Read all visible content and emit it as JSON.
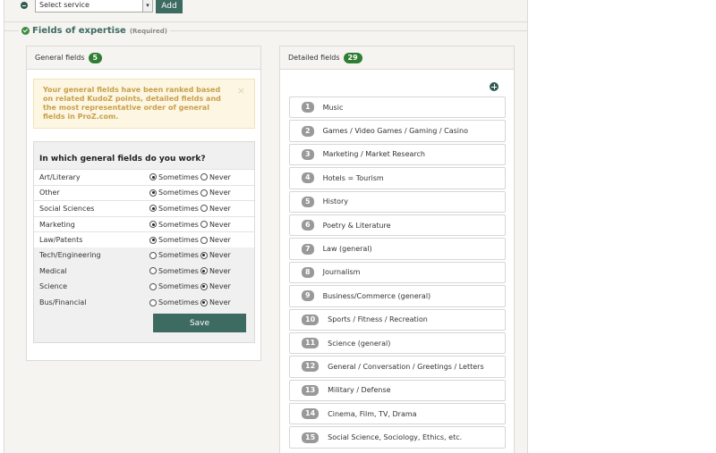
{
  "service": {
    "select_value": "Select service",
    "add_label": "Add"
  },
  "section": {
    "title": "Fields of expertise",
    "required": "(Required)"
  },
  "general": {
    "header": "General fields",
    "count": "5",
    "notice": "Your general fields have been ranked based on related KudoZ points, detailed fields and the most representative order of general fields in ProZ.com.",
    "close_glyph": "×",
    "question": "In which general fields do you work?",
    "option_sometimes": "Sometimes",
    "option_never": "Never",
    "rows": [
      {
        "label": "Art/Literary",
        "value": "Sometimes"
      },
      {
        "label": "Other",
        "value": "Sometimes"
      },
      {
        "label": "Social Sciences",
        "value": "Sometimes"
      },
      {
        "label": "Marketing",
        "value": "Sometimes"
      },
      {
        "label": "Law/Patents",
        "value": "Sometimes"
      },
      {
        "label": "Tech/Engineering",
        "value": "Never"
      },
      {
        "label": "Medical",
        "value": "Never"
      },
      {
        "label": "Science",
        "value": "Never"
      },
      {
        "label": "Bus/Financial",
        "value": "Never"
      }
    ],
    "save_label": "Save"
  },
  "detailed": {
    "header": "Detailed fields",
    "count": "29",
    "items": [
      {
        "num": "1",
        "label": "Music"
      },
      {
        "num": "2",
        "label": "Games / Video Games / Gaming / Casino"
      },
      {
        "num": "3",
        "label": "Marketing / Market Research"
      },
      {
        "num": "4",
        "label": "Hotels = Tourism"
      },
      {
        "num": "5",
        "label": "History"
      },
      {
        "num": "6",
        "label": "Poetry & Literature"
      },
      {
        "num": "7",
        "label": "Law (general)"
      },
      {
        "num": "8",
        "label": "Journalism"
      },
      {
        "num": "9",
        "label": "Business/Commerce (general)"
      },
      {
        "num": "10",
        "label": "Sports / Fitness / Recreation"
      },
      {
        "num": "11",
        "label": "Science (general)"
      },
      {
        "num": "12",
        "label": "General / Conversation / Greetings / Letters"
      },
      {
        "num": "13",
        "label": "Military / Defense"
      },
      {
        "num": "14",
        "label": "Cinema, Film, TV, Drama"
      },
      {
        "num": "15",
        "label": "Social Science, Sociology, Ethics, etc."
      }
    ]
  }
}
